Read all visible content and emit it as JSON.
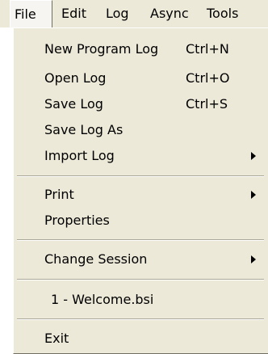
{
  "menubar": {
    "items": [
      {
        "label": "File"
      },
      {
        "label": "Edit"
      },
      {
        "label": "Log"
      },
      {
        "label": "Async"
      },
      {
        "label": "Tools"
      }
    ]
  },
  "file_menu": {
    "items": [
      {
        "label": "New Program Log",
        "shortcut": "Ctrl+N"
      },
      {
        "label": "Open Log",
        "shortcut": "Ctrl+O"
      },
      {
        "label": "Save Log",
        "shortcut": "Ctrl+S"
      },
      {
        "label": "Save Log As"
      },
      {
        "label": "Import Log",
        "submenu": true
      },
      {
        "label": "Print",
        "submenu": true
      },
      {
        "label": "Properties"
      },
      {
        "label": "Change Session",
        "submenu": true
      },
      {
        "label": "1 - Welcome.bsi"
      },
      {
        "label": "Exit"
      }
    ]
  }
}
